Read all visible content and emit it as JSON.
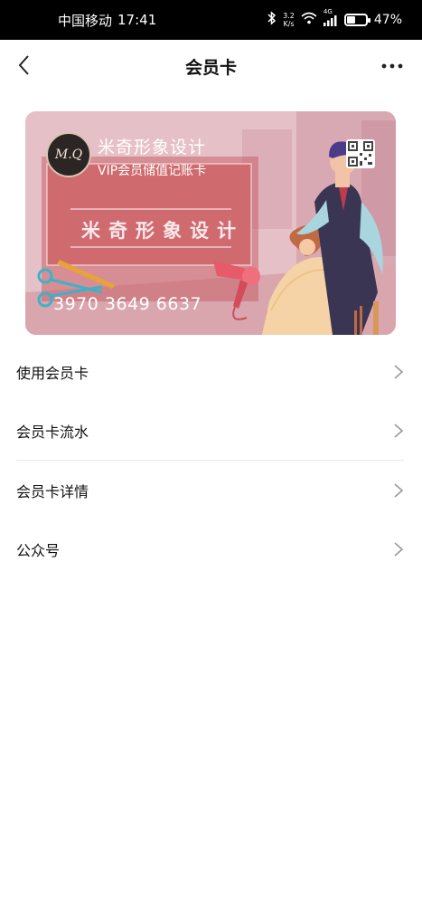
{
  "status_bar": {
    "carrier": "中国移动",
    "time": "17:41",
    "speed_value": "3.2",
    "speed_unit": "K/s",
    "network": "4G",
    "battery_level": 0.47,
    "battery_text": "47%"
  },
  "header": {
    "title": "会员卡",
    "back_icon": "chevron-left-icon",
    "more_icon": "more-dots-icon"
  },
  "card": {
    "logo_text": "M.Q",
    "store_name": "米奇形象设计",
    "card_type": "VIP会员储值记账卡",
    "brand_text": "米奇形象设计",
    "card_number": "3970 3649 6637",
    "qr_icon": "qr-code-icon",
    "colors": {
      "background": "#e3b8c0",
      "panel": "#cf6a6f",
      "accent": "#3c4b8c"
    }
  },
  "menu": {
    "items": [
      {
        "label": "使用会员卡"
      },
      {
        "label": "会员卡流水"
      },
      {
        "label": "会员卡详情"
      },
      {
        "label": "公众号"
      }
    ]
  }
}
